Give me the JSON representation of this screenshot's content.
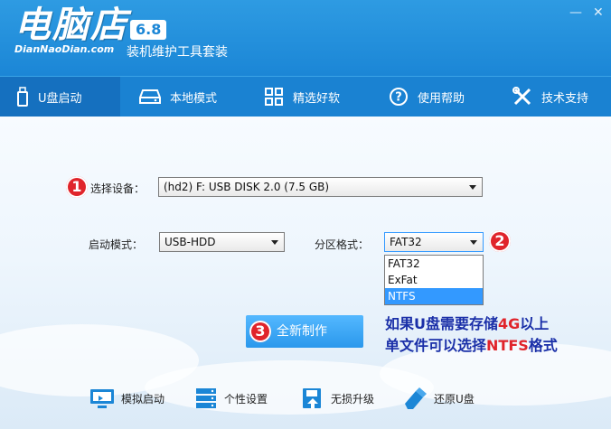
{
  "header": {
    "logo_main": "电脑店",
    "logo_sub": "DianNaoDian.com",
    "version": "6.8",
    "subtitle": "装机维护工具套装",
    "window_minimize": "—",
    "window_close": "✕"
  },
  "nav": [
    {
      "label": "U盘启动",
      "icon": "usb-drive-icon"
    },
    {
      "label": "本地模式",
      "icon": "hard-disk-icon"
    },
    {
      "label": "精选好软",
      "icon": "grid-icon"
    },
    {
      "label": "使用帮助",
      "icon": "help-icon"
    },
    {
      "label": "技术支持",
      "icon": "tools-icon"
    }
  ],
  "form": {
    "badge1": "1",
    "badge2": "2",
    "badge3": "3",
    "device_label": "选择设备：",
    "device_value": "(hd2) F: USB DISK 2.0 (7.5 GB)",
    "boot_mode_label": "启动模式：",
    "boot_mode_value": "USB-HDD",
    "partition_label": "分区格式：",
    "partition_value": "FAT32",
    "partition_options": [
      "FAT32",
      "ExFat",
      "NTFS"
    ],
    "partition_highlighted": "NTFS"
  },
  "make_button": "全新制作",
  "note": {
    "line1_a": "如果U盘需要存储",
    "line1_hl": "4G",
    "line1_b": "以上",
    "line2_a": "单文件可以选择",
    "line2_hl": "NTFS",
    "line2_b": "格式"
  },
  "tools": [
    {
      "label": "模拟启动",
      "icon": "monitor-icon"
    },
    {
      "label": "个性设置",
      "icon": "server-settings-icon"
    },
    {
      "label": "无损升级",
      "icon": "upgrade-icon"
    },
    {
      "label": "还原U盘",
      "icon": "usb-eraser-icon"
    }
  ],
  "colors": {
    "header_blue": "#1b86d6",
    "nav_active": "#1570bf",
    "badge_red": "#e0242b",
    "note_blue": "#1a2fa8",
    "selection_blue": "#3399ff"
  }
}
